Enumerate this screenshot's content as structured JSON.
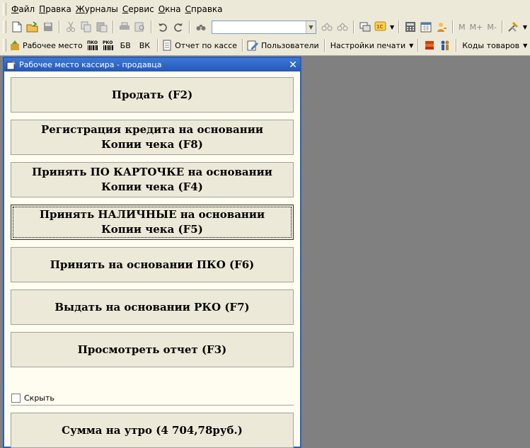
{
  "menu": {
    "items": [
      {
        "u": "Ф",
        "rest": "айл"
      },
      {
        "u": "П",
        "rest": "равка"
      },
      {
        "u": "Ж",
        "rest": "урналы"
      },
      {
        "u": "С",
        "rest": "ервис"
      },
      {
        "u": "О",
        "rest": "кна"
      },
      {
        "u": "С",
        "rest": "правка"
      }
    ]
  },
  "toolbar2": {
    "workplace": "Рабочее место",
    "pko": "ПКО",
    "rko": "РКО",
    "bv": "БВ",
    "vk": "ВК",
    "report": "Отчет по кассе",
    "users": "Пользователи",
    "print_settings": "Настройки печати",
    "codes": "Коды товаров"
  },
  "toolbar1": {
    "m": "M",
    "mplus": "M+",
    "mminus": "M-",
    "search_value": ""
  },
  "window": {
    "title": "Рабочее место кассира - продавца",
    "buttons": [
      "Продать (F2)",
      "Регистрация кредита на основании\nКопии чека (F8)",
      "Принять ПО КАРТОЧКЕ на основании\nКопии чека (F4)",
      "Принять НАЛИЧНЫЕ на основании\nКопии чека (F5)",
      "Принять на основании ПКО (F6)",
      "Выдать на основании РКО (F7)",
      "Просмотреть отчет (F3)"
    ],
    "hide_label": "Скрыть",
    "morning_sum": "Сумма на утро (4 704,78руб.)"
  },
  "colors": {
    "title_bar": "#2a61c4",
    "workspace": "#808080",
    "panel": "#ece9d8"
  }
}
